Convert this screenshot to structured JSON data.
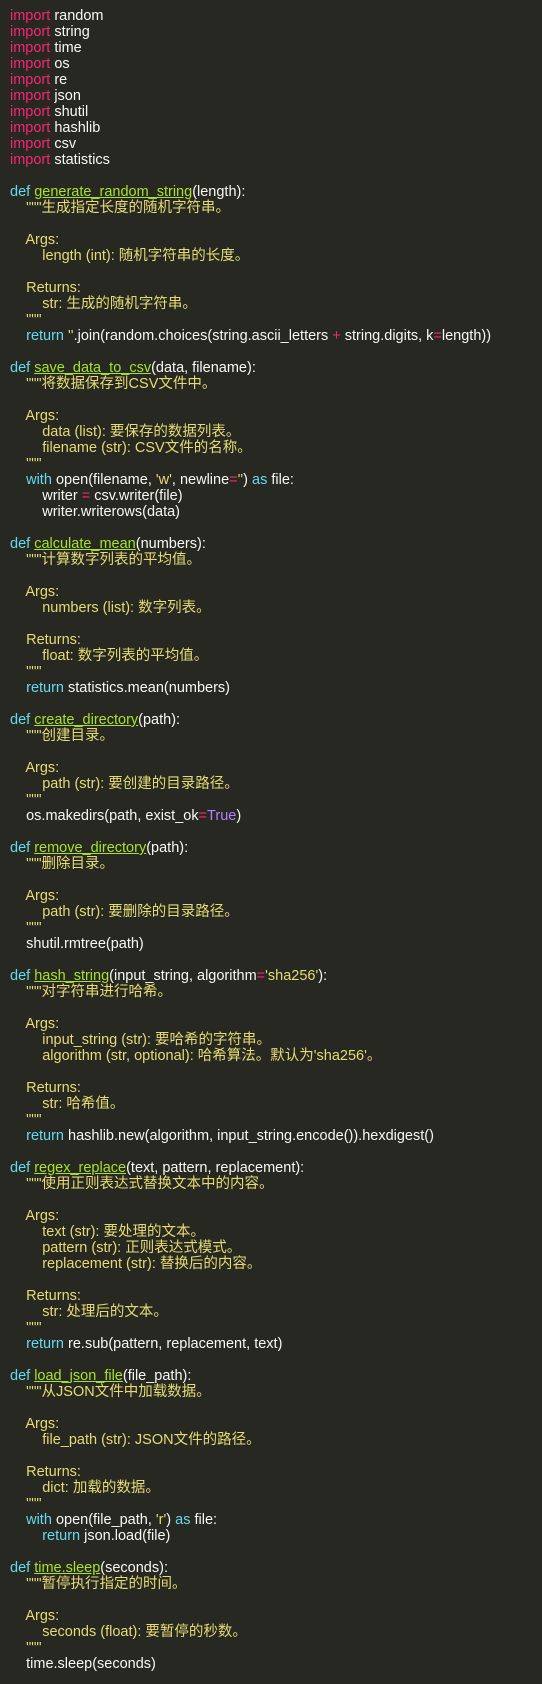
{
  "editor": {
    "theme_colors": {
      "background": "#272822",
      "keyword": "#f92672",
      "definition": "#66d9ef",
      "function": "#a6e22e",
      "string": "#e6db74",
      "text": "#f8f8f2"
    },
    "lines": [
      [
        {
          "t": "kw",
          "v": "import"
        },
        {
          "t": "txt",
          "v": " random"
        }
      ],
      [
        {
          "t": "kw",
          "v": "import"
        },
        {
          "t": "txt",
          "v": " string"
        }
      ],
      [
        {
          "t": "kw",
          "v": "import"
        },
        {
          "t": "txt",
          "v": " time"
        }
      ],
      [
        {
          "t": "kw",
          "v": "import"
        },
        {
          "t": "txt",
          "v": " os"
        }
      ],
      [
        {
          "t": "kw",
          "v": "import"
        },
        {
          "t": "txt",
          "v": " re"
        }
      ],
      [
        {
          "t": "kw",
          "v": "import"
        },
        {
          "t": "txt",
          "v": " json"
        }
      ],
      [
        {
          "t": "kw",
          "v": "import"
        },
        {
          "t": "txt",
          "v": " shutil"
        }
      ],
      [
        {
          "t": "kw",
          "v": "import"
        },
        {
          "t": "txt",
          "v": " hashlib"
        }
      ],
      [
        {
          "t": "kw",
          "v": "import"
        },
        {
          "t": "txt",
          "v": " csv"
        }
      ],
      [
        {
          "t": "kw",
          "v": "import"
        },
        {
          "t": "txt",
          "v": " statistics"
        }
      ],
      [],
      [
        {
          "t": "def",
          "v": "def "
        },
        {
          "t": "fn",
          "v": "generate_random_string"
        },
        {
          "t": "txt",
          "v": "(length):"
        }
      ],
      [
        {
          "t": "doc",
          "v": "    \"\"\"生成指定长度的随机字符串。"
        }
      ],
      [],
      [
        {
          "t": "doc",
          "v": "    Args:"
        }
      ],
      [
        {
          "t": "doc",
          "v": "        length (int): 随机字符串的长度。"
        }
      ],
      [],
      [
        {
          "t": "doc",
          "v": "    Returns:"
        }
      ],
      [
        {
          "t": "doc",
          "v": "        str: 生成的随机字符串。"
        }
      ],
      [
        {
          "t": "doc",
          "v": "    \"\"\""
        }
      ],
      [
        {
          "t": "def",
          "v": "    return "
        },
        {
          "t": "str",
          "v": "''"
        },
        {
          "t": "txt",
          "v": ".join(random.choices(string.ascii_letters "
        },
        {
          "t": "op",
          "v": "+"
        },
        {
          "t": "txt",
          "v": " string.digits, k"
        },
        {
          "t": "op",
          "v": "="
        },
        {
          "t": "txt",
          "v": "length))"
        }
      ],
      [],
      [
        {
          "t": "def",
          "v": "def "
        },
        {
          "t": "fn",
          "v": "save_data_to_csv"
        },
        {
          "t": "txt",
          "v": "(data, filename):"
        }
      ],
      [
        {
          "t": "doc",
          "v": "    \"\"\"将数据保存到CSV文件中。"
        }
      ],
      [],
      [
        {
          "t": "doc",
          "v": "    Args:"
        }
      ],
      [
        {
          "t": "doc",
          "v": "        data (list): 要保存的数据列表。"
        }
      ],
      [
        {
          "t": "doc",
          "v": "        filename (str): CSV文件的名称。"
        }
      ],
      [
        {
          "t": "doc",
          "v": "    \"\"\""
        }
      ],
      [
        {
          "t": "def",
          "v": "    with "
        },
        {
          "t": "txt",
          "v": "open(filename, "
        },
        {
          "t": "str",
          "v": "'w'"
        },
        {
          "t": "txt",
          "v": ", newline"
        },
        {
          "t": "op",
          "v": "="
        },
        {
          "t": "str",
          "v": "''"
        },
        {
          "t": "txt",
          "v": ") "
        },
        {
          "t": "def",
          "v": "as"
        },
        {
          "t": "txt",
          "v": " file:"
        }
      ],
      [
        {
          "t": "txt",
          "v": "        writer "
        },
        {
          "t": "op",
          "v": "="
        },
        {
          "t": "txt",
          "v": " csv.writer(file)"
        }
      ],
      [
        {
          "t": "txt",
          "v": "        writer.writerows(data)"
        }
      ],
      [],
      [
        {
          "t": "def",
          "v": "def "
        },
        {
          "t": "fn",
          "v": "calculate_mean"
        },
        {
          "t": "txt",
          "v": "(numbers):"
        }
      ],
      [
        {
          "t": "doc",
          "v": "    \"\"\"计算数字列表的平均值。"
        }
      ],
      [],
      [
        {
          "t": "doc",
          "v": "    Args:"
        }
      ],
      [
        {
          "t": "doc",
          "v": "        numbers (list): 数字列表。"
        }
      ],
      [],
      [
        {
          "t": "doc",
          "v": "    Returns:"
        }
      ],
      [
        {
          "t": "doc",
          "v": "        float: 数字列表的平均值。"
        }
      ],
      [
        {
          "t": "doc",
          "v": "    \"\"\""
        }
      ],
      [
        {
          "t": "def",
          "v": "    return "
        },
        {
          "t": "txt",
          "v": "statistics.mean(numbers)"
        }
      ],
      [],
      [
        {
          "t": "def",
          "v": "def "
        },
        {
          "t": "fn",
          "v": "create_directory"
        },
        {
          "t": "txt",
          "v": "(path):"
        }
      ],
      [
        {
          "t": "doc",
          "v": "    \"\"\"创建目录。"
        }
      ],
      [],
      [
        {
          "t": "doc",
          "v": "    Args:"
        }
      ],
      [
        {
          "t": "doc",
          "v": "        path (str): 要创建的目录路径。"
        }
      ],
      [
        {
          "t": "doc",
          "v": "    \"\"\""
        }
      ],
      [
        {
          "t": "txt",
          "v": "    os.makedirs(path, exist_ok"
        },
        {
          "t": "op",
          "v": "="
        },
        {
          "t": "bool",
          "v": "True"
        },
        {
          "t": "txt",
          "v": ")"
        }
      ],
      [],
      [
        {
          "t": "def",
          "v": "def "
        },
        {
          "t": "fn",
          "v": "remove_directory"
        },
        {
          "t": "txt",
          "v": "(path):"
        }
      ],
      [
        {
          "t": "doc",
          "v": "    \"\"\"删除目录。"
        }
      ],
      [],
      [
        {
          "t": "doc",
          "v": "    Args:"
        }
      ],
      [
        {
          "t": "doc",
          "v": "        path (str): 要删除的目录路径。"
        }
      ],
      [
        {
          "t": "doc",
          "v": "    \"\"\""
        }
      ],
      [
        {
          "t": "txt",
          "v": "    shutil.rmtree(path)"
        }
      ],
      [],
      [
        {
          "t": "def",
          "v": "def "
        },
        {
          "t": "fn",
          "v": "hash_string"
        },
        {
          "t": "txt",
          "v": "(input_string, algorithm"
        },
        {
          "t": "op",
          "v": "="
        },
        {
          "t": "str",
          "v": "'sha256'"
        },
        {
          "t": "txt",
          "v": "):"
        }
      ],
      [
        {
          "t": "doc",
          "v": "    \"\"\"对字符串进行哈希。"
        }
      ],
      [],
      [
        {
          "t": "doc",
          "v": "    Args:"
        }
      ],
      [
        {
          "t": "doc",
          "v": "        input_string (str): 要哈希的字符串。"
        }
      ],
      [
        {
          "t": "doc",
          "v": "        algorithm (str, optional): 哈希算法。默认为'sha256'。"
        }
      ],
      [],
      [
        {
          "t": "doc",
          "v": "    Returns:"
        }
      ],
      [
        {
          "t": "doc",
          "v": "        str: 哈希值。"
        }
      ],
      [
        {
          "t": "doc",
          "v": "    \"\"\""
        }
      ],
      [
        {
          "t": "def",
          "v": "    return "
        },
        {
          "t": "txt",
          "v": "hashlib.new(algorithm, input_string.encode()).hexdigest()"
        }
      ],
      [],
      [
        {
          "t": "def",
          "v": "def "
        },
        {
          "t": "fn",
          "v": "regex_replace"
        },
        {
          "t": "txt",
          "v": "(text, pattern, replacement):"
        }
      ],
      [
        {
          "t": "doc",
          "v": "    \"\"\"使用正则表达式替换文本中的内容。"
        }
      ],
      [],
      [
        {
          "t": "doc",
          "v": "    Args:"
        }
      ],
      [
        {
          "t": "doc",
          "v": "        text (str): 要处理的文本。"
        }
      ],
      [
        {
          "t": "doc",
          "v": "        pattern (str): 正则表达式模式。"
        }
      ],
      [
        {
          "t": "doc",
          "v": "        replacement (str): 替换后的内容。"
        }
      ],
      [],
      [
        {
          "t": "doc",
          "v": "    Returns:"
        }
      ],
      [
        {
          "t": "doc",
          "v": "        str: 处理后的文本。"
        }
      ],
      [
        {
          "t": "doc",
          "v": "    \"\"\""
        }
      ],
      [
        {
          "t": "def",
          "v": "    return "
        },
        {
          "t": "txt",
          "v": "re.sub(pattern, replacement, text)"
        }
      ],
      [],
      [
        {
          "t": "def",
          "v": "def "
        },
        {
          "t": "fn",
          "v": "load_json_file"
        },
        {
          "t": "txt",
          "v": "(file_path):"
        }
      ],
      [
        {
          "t": "doc",
          "v": "    \"\"\"从JSON文件中加载数据。"
        }
      ],
      [],
      [
        {
          "t": "doc",
          "v": "    Args:"
        }
      ],
      [
        {
          "t": "doc",
          "v": "        file_path (str): JSON文件的路径。"
        }
      ],
      [],
      [
        {
          "t": "doc",
          "v": "    Returns:"
        }
      ],
      [
        {
          "t": "doc",
          "v": "        dict: 加载的数据。"
        }
      ],
      [
        {
          "t": "doc",
          "v": "    \"\"\""
        }
      ],
      [
        {
          "t": "def",
          "v": "    with "
        },
        {
          "t": "txt",
          "v": "open(file_path, "
        },
        {
          "t": "str",
          "v": "'r'"
        },
        {
          "t": "txt",
          "v": ") "
        },
        {
          "t": "def",
          "v": "as"
        },
        {
          "t": "txt",
          "v": " file:"
        }
      ],
      [
        {
          "t": "def",
          "v": "        return "
        },
        {
          "t": "txt",
          "v": "json.load(file)"
        }
      ],
      [],
      [
        {
          "t": "def",
          "v": "def "
        },
        {
          "t": "fn",
          "v": "time.sleep"
        },
        {
          "t": "txt",
          "v": "(seconds):"
        }
      ],
      [
        {
          "t": "doc",
          "v": "    \"\"\"暂停执行指定的时间。"
        }
      ],
      [],
      [
        {
          "t": "doc",
          "v": "    Args:"
        }
      ],
      [
        {
          "t": "doc",
          "v": "        seconds (float): 要暂停的秒数。"
        }
      ],
      [
        {
          "t": "doc",
          "v": "    \"\"\""
        }
      ],
      [
        {
          "t": "txt",
          "v": "    time.sleep(seconds)"
        }
      ]
    ]
  }
}
